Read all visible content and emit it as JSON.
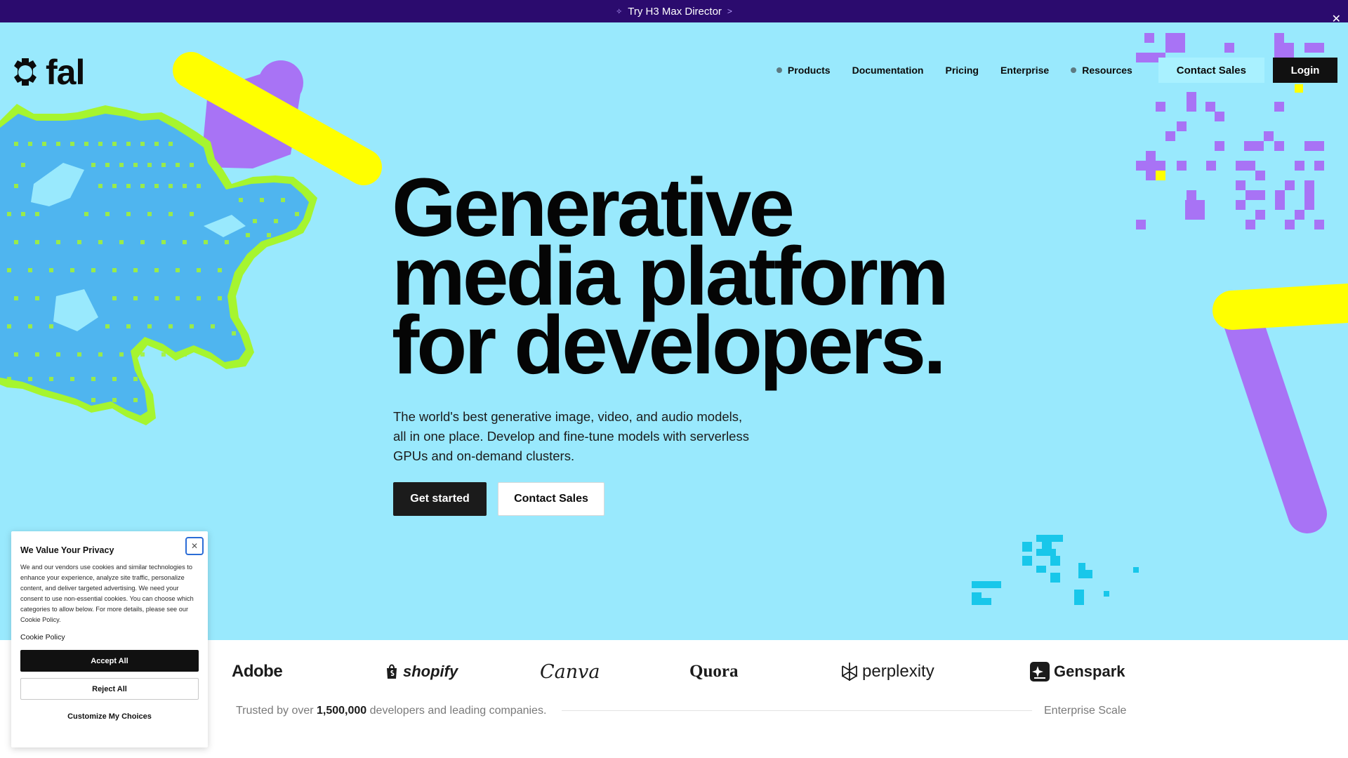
{
  "announcement": {
    "text": "Try H3 Max Director",
    "icon": "sparkle-icon",
    "arrow": ">",
    "close": "✕"
  },
  "brand": {
    "name": "fal",
    "icon": "fal-logo-icon"
  },
  "nav": {
    "items": [
      {
        "label": "Products",
        "has_dot": true
      },
      {
        "label": "Documentation",
        "has_dot": false
      },
      {
        "label": "Pricing",
        "has_dot": false
      },
      {
        "label": "Enterprise",
        "has_dot": false
      },
      {
        "label": "Resources",
        "has_dot": true
      }
    ],
    "contact_label": "Contact Sales",
    "login_label": "Login"
  },
  "hero": {
    "headline_lines": [
      "Generative",
      "media platform",
      "for developers."
    ],
    "subtitle": "The world's best generative image, video, and audio models, all in one place. Develop and fine-tune models with serverless GPUs and on-demand clusters.",
    "primary_cta": "Get started",
    "secondary_cta": "Contact Sales"
  },
  "brands": {
    "logos": [
      "Adobe",
      "shopify",
      "Canva",
      "Quora",
      "perplexity",
      "Genspark"
    ],
    "trust_prefix": "Trusted by over",
    "trust_count": "1,500,000",
    "trust_suffix": "developers and leading companies.",
    "scale_label": "Enterprise Scale"
  },
  "cookie": {
    "title": "We Value Your Privacy",
    "body": "We and our vendors use cookies and similar technologies to enhance your experience, analyze site traffic, personalize content, and deliver targeted advertising. We need your consent to use non-essential cookies. You can choose which categories to allow below. For more details, please see our Cookie Policy.",
    "policy_link": "Cookie Policy",
    "accept": "Accept All",
    "reject": "Reject All",
    "customize": "Customize My Choices",
    "close": "✕"
  },
  "colors": {
    "hero_bg": "#99e9fd",
    "announcement_bg": "#2b0b6e",
    "accent_yellow": "#ffff00",
    "accent_purple": "#a873f5",
    "accent_green": "#a6f52f",
    "accent_blue": "#4fb5ef",
    "accent_cyan": "#18c7ea"
  }
}
